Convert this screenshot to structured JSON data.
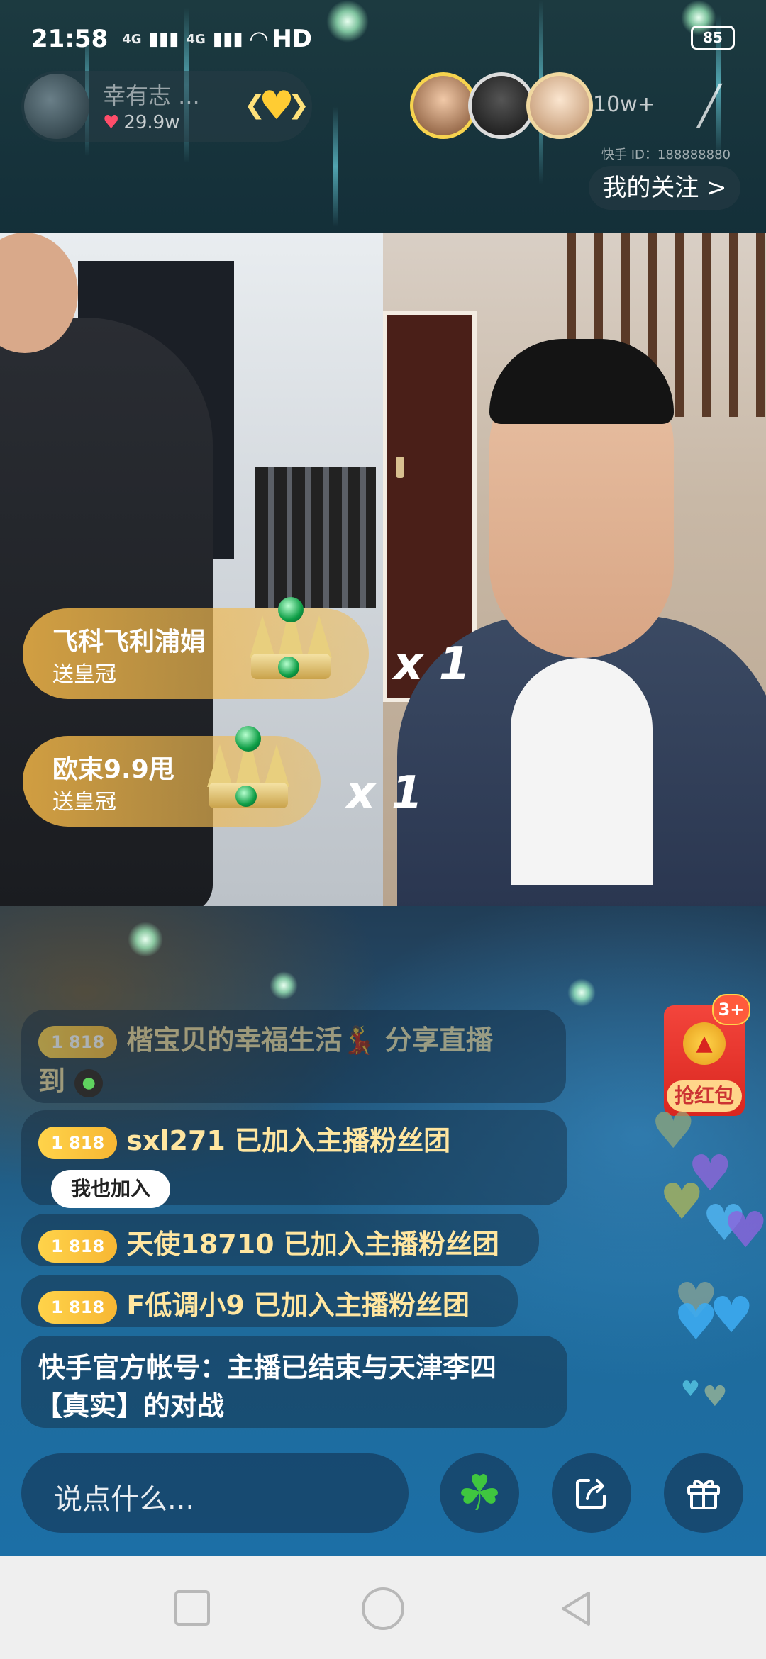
{
  "status_bar": {
    "time": "21:58",
    "signal1": "4G",
    "signal2": "4G",
    "network": "HD",
    "battery": "85"
  },
  "host": {
    "name": "幸有志 ...",
    "likes": "29.9w"
  },
  "viewers": {
    "count": "10w+"
  },
  "kuaishou_id": "快手 ID：188888880",
  "follow_button": "我的关注 >",
  "gifts": [
    {
      "sender": "飞科飞利浦娟",
      "action": "送皇冠",
      "multiplier": "x 1"
    },
    {
      "sender": "欧束9.9甩",
      "action": "送皇冠",
      "multiplier": "x 1"
    }
  ],
  "chat": [
    {
      "level": "1  818",
      "text": "楷宝贝的幸福生活💃 分享直播",
      "text2": "到"
    },
    {
      "level": "1  818",
      "text": "sxl271 已加入主播粉丝团",
      "button": "我也加入"
    },
    {
      "level": "1  818",
      "text": "天使18710 已加入主播粉丝团"
    },
    {
      "level": "1  818",
      "text": "F低调小9 已加入主播粉丝团"
    },
    {
      "text": "快手官方帐号：主播已结束与天津李四",
      "text2": "【真实】的对战"
    }
  ],
  "red_packet": {
    "label": "抢红包",
    "badge": "3+"
  },
  "input": {
    "placeholder": "说点什么..."
  },
  "colors": {
    "accent": "#f7b733",
    "red_packet": "#d9261f",
    "gift_banner": "#f0b446"
  }
}
